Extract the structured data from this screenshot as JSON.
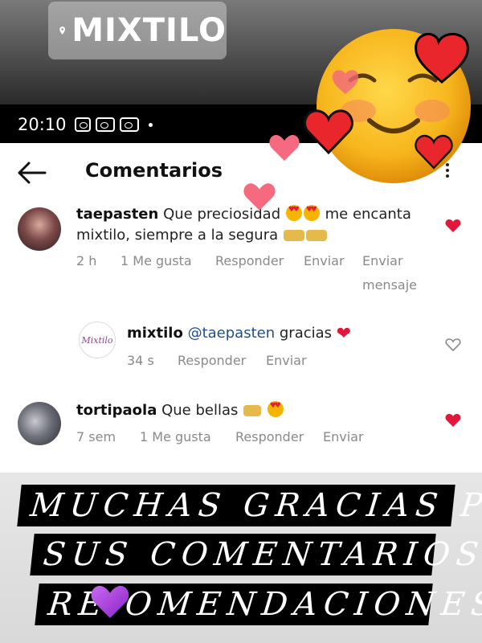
{
  "location_sticker": {
    "label": "MIXTILO"
  },
  "status_bar": {
    "time": "20:10"
  },
  "header": {
    "title": "Comentarios"
  },
  "comments": [
    {
      "username": "taepasten",
      "text_part1": "Que preciosidad",
      "text_part2": "me encanta",
      "text_line2": "mixtilo, siempre a la segura",
      "time": "2 h",
      "likes": "1 Me gusta",
      "reply": "Responder",
      "send": "Enviar",
      "send_message": "Enviar",
      "send_message_line2": "mensaje",
      "liked": true
    },
    {
      "username": "mixtilo",
      "mention": "@taepasten",
      "text": "gracias",
      "time": "34 s",
      "reply": "Responder",
      "send": "Enviar",
      "avatar_text": "Mixtilo",
      "liked": false
    },
    {
      "username": "tortipaola",
      "text": "Que bellas",
      "time": "7 sem",
      "likes": "1 Me gusta",
      "reply": "Responder",
      "send": "Enviar",
      "liked": true
    }
  ],
  "banner": {
    "line1": "MUCHAS GRACIAS POR",
    "line2": "SUS COMENTARIOS Y",
    "line3": "RE   OMENDACIONES"
  },
  "colors": {
    "heart_red": "#e3173a",
    "emoji_yellow": "#f7b51c",
    "sticker_purple": "#a23ae0"
  }
}
